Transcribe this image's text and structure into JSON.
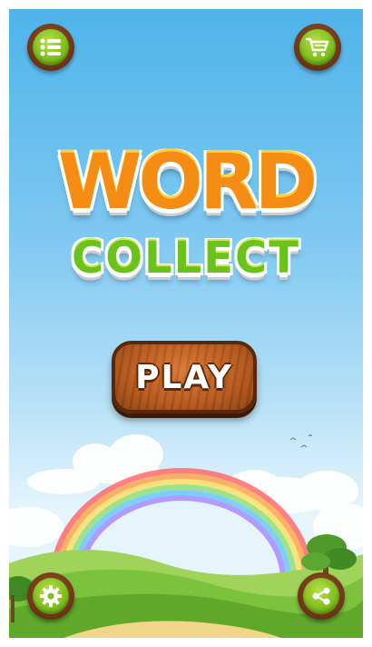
{
  "title": {
    "line1": "WORD",
    "line2": "COLLECT"
  },
  "buttons": {
    "play_label": "PLAY",
    "menu": {
      "icon": "list-icon"
    },
    "cart": {
      "icon": "shopping-cart-icon"
    },
    "settings": {
      "icon": "gear-icon"
    },
    "share": {
      "icon": "share-icon"
    }
  },
  "colors": {
    "sky_top": "#4fb4ea",
    "button_wood": "#6a3415",
    "button_green": "#7fbf1e",
    "title_orange": "#f58d14",
    "title_green": "#6cc21c",
    "play_wood": "#b35519"
  }
}
